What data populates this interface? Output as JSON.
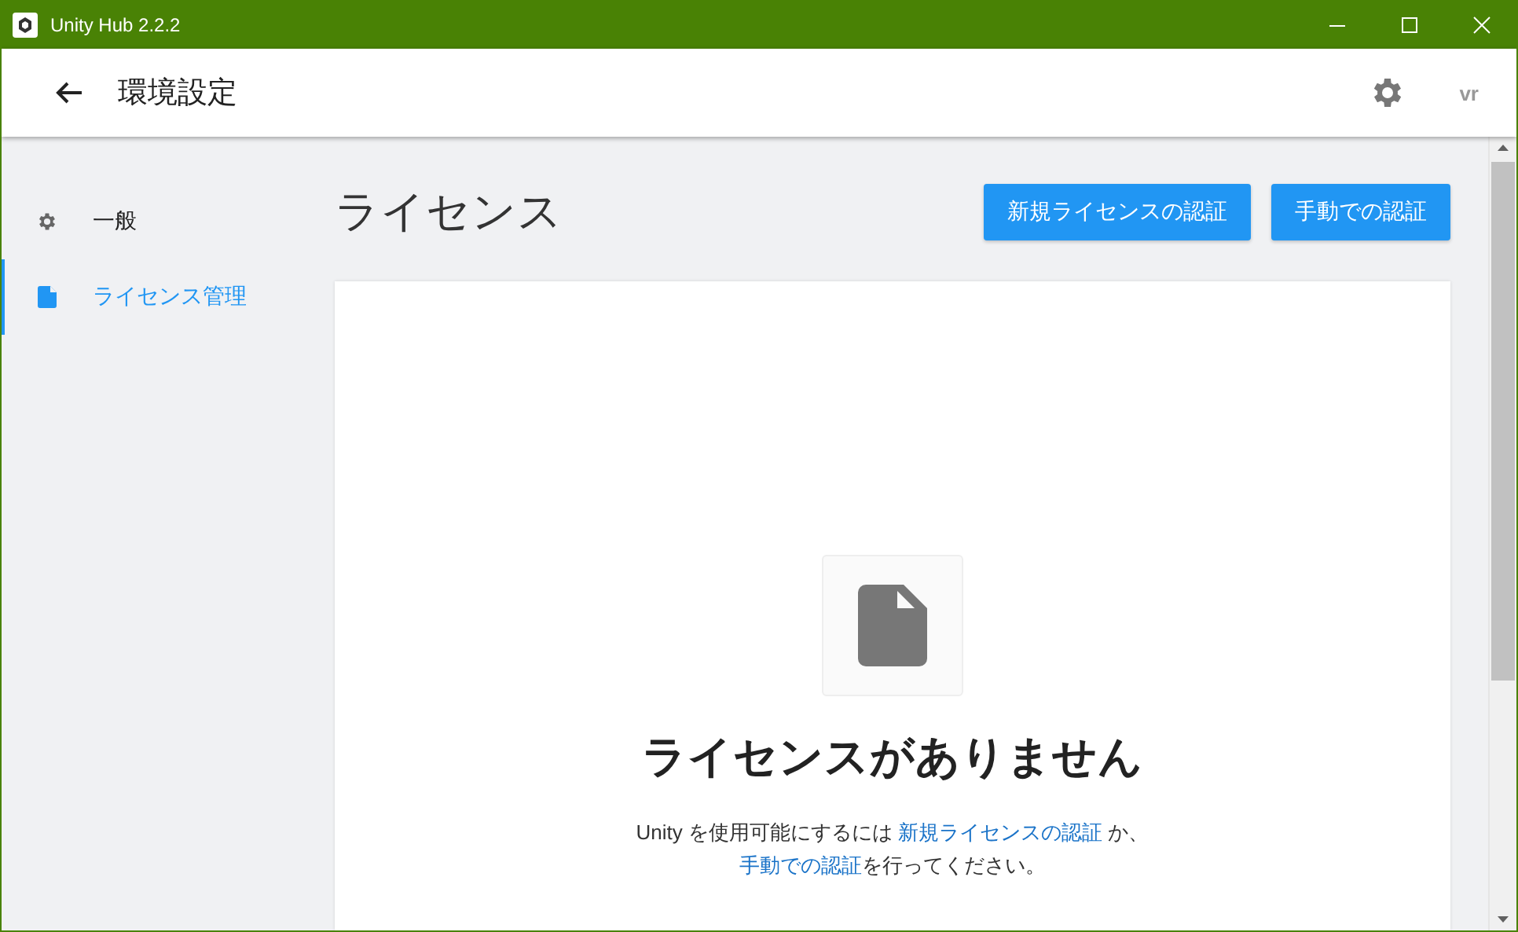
{
  "window": {
    "title": "Unity Hub 2.2.2"
  },
  "header": {
    "title": "環境設定",
    "user": "vr"
  },
  "sidebar": {
    "items": [
      {
        "label": "一般",
        "kind": "gear",
        "selected": false
      },
      {
        "label": "ライセンス管理",
        "kind": "document",
        "selected": true
      }
    ]
  },
  "page": {
    "title": "ライセンス",
    "buttons": [
      "新規ライセンスの認証",
      "手動での認証"
    ]
  },
  "empty_state": {
    "heading": "ライセンスがありません",
    "message_lines": [
      [
        {
          "kind": "text",
          "text": "Unity を使用可能にするには "
        },
        {
          "kind": "link",
          "text": "新規ライセンスの認証"
        },
        {
          "kind": "text",
          "text": " か、"
        }
      ],
      [
        {
          "kind": "link",
          "text": "手動での認証"
        },
        {
          "kind": "text",
          "text": "を行ってください。"
        }
      ]
    ]
  }
}
